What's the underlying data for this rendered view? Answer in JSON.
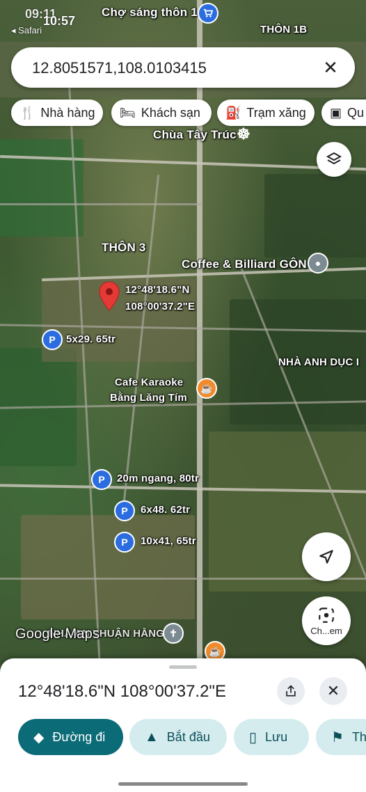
{
  "status": {
    "time": "09:11",
    "time_overlay": "10:57",
    "back_app": "◂ Safari",
    "area_label": "THÔN 1B"
  },
  "search": {
    "query": "12.8051571,108.0103415",
    "clear_icon": "close-icon"
  },
  "chips": [
    {
      "label": "Nhà hàng",
      "icon": "restaurant-icon"
    },
    {
      "label": "Khách sạn",
      "icon": "hotel-icon"
    },
    {
      "label": "Trạm xăng",
      "icon": "gas-station-icon"
    },
    {
      "label": "Qu",
      "icon": "shop-icon"
    }
  ],
  "map": {
    "labels": {
      "cho_sang": "Chợ sáng thôn 1",
      "chua": "Chùa Tây Trúc",
      "thon3": "THÔN 3",
      "coffee": "Coffee & Billiard GÔN",
      "pin_lat": "12°48'18.6\"N",
      "pin_lng": "108°00'37.2\"E",
      "p1": "5x29. 65tr",
      "nha_anh": "NHÀ ANH DỤC I",
      "cafe1": "Cafe Karaoke",
      "cafe2": "Bằng Lăng Tím",
      "p2": "20m ngang, 80tr",
      "p3": "6x48. 62tr",
      "p4": "10x41, 65tr",
      "thuan_hang": "NHÀ AN THUẬN HẰNG",
      "watermark": "Google Maps",
      "lens_label": "Ch...em"
    }
  },
  "sheet": {
    "coords": "12°48'18.6\"N 108°00'37.2\"E",
    "actions": [
      {
        "label": "Đường đi",
        "icon": "directions-icon"
      },
      {
        "label": "Bắt đầu",
        "icon": "navigation-icon"
      },
      {
        "label": "Lưu",
        "icon": "bookmark-icon"
      },
      {
        "label": "Th",
        "icon": "flag-icon"
      }
    ]
  },
  "colors": {
    "accent": "#0b6b77",
    "accent_light": "#d5ecef",
    "pin_red": "#e53935",
    "marker_blue": "#2b6de0",
    "marker_orange": "#f08b2d"
  }
}
